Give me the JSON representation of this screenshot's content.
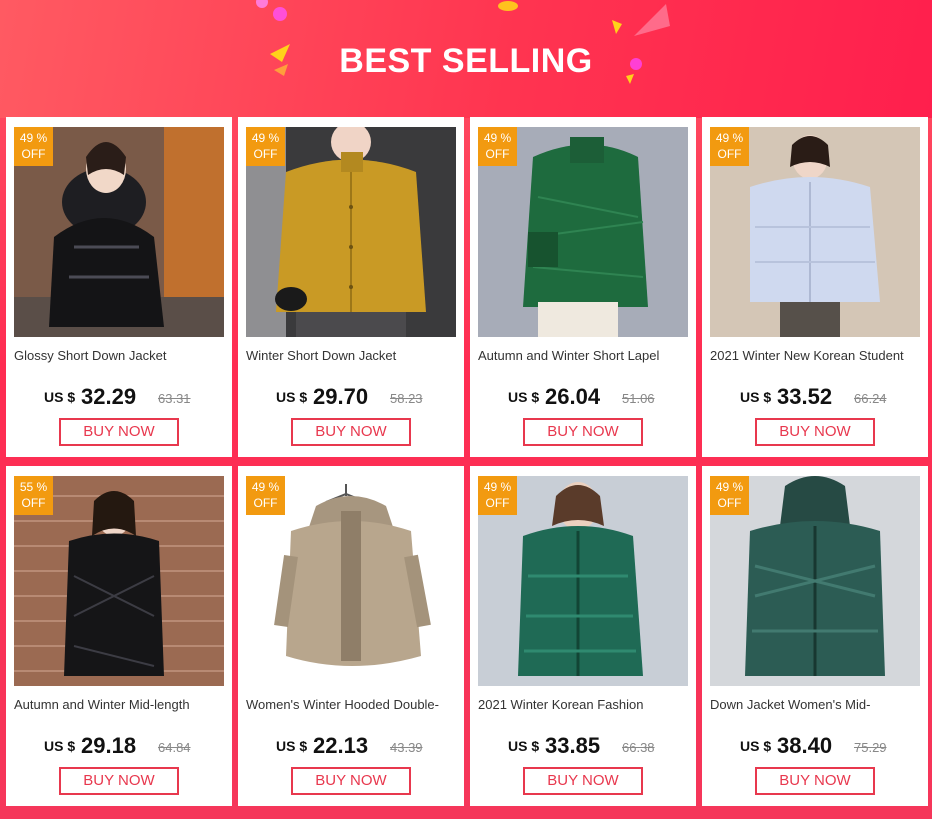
{
  "banner": {
    "title": "BEST SELLING"
  },
  "colors": {
    "accent": "#e8384e",
    "badge": "#f29a10",
    "background": "#ff3450"
  },
  "products": [
    {
      "name": "Glossy Short Down Jacket",
      "discount": "49 %",
      "off": "OFF",
      "currency": "US $",
      "price": "32.29",
      "old_price": "63.31",
      "button": "BUY NOW",
      "image": "black-glossy-fur-hood-jacket"
    },
    {
      "name": "Winter Short Down Jacket",
      "discount": "49 %",
      "off": "OFF",
      "currency": "US $",
      "price": "29.70",
      "old_price": "58.23",
      "button": "BUY NOW",
      "image": "mustard-short-down-jacket"
    },
    {
      "name": "Autumn and Winter Short Lapel",
      "discount": "49 %",
      "off": "OFF",
      "currency": "US $",
      "price": "26.04",
      "old_price": "51.06",
      "button": "BUY NOW",
      "image": "green-quilted-lapel-jacket"
    },
    {
      "name": "2021 Winter New Korean Student",
      "discount": "49 %",
      "off": "OFF",
      "currency": "US $",
      "price": "33.52",
      "old_price": "66.24",
      "button": "BUY NOW",
      "image": "light-blue-puffer-jacket"
    },
    {
      "name": "Autumn and Winter Mid-length",
      "discount": "55 %",
      "off": "OFF",
      "currency": "US $",
      "price": "29.18",
      "old_price": "64.84",
      "button": "BUY NOW",
      "image": "black-quilted-mid-length-coat"
    },
    {
      "name": "Women's Winter Hooded Double-",
      "discount": "49 %",
      "off": "OFF",
      "currency": "US $",
      "price": "22.13",
      "old_price": "43.39",
      "button": "BUY NOW",
      "image": "beige-fleece-hooded-coat"
    },
    {
      "name": "2021 Winter Korean Fashion",
      "discount": "49 %",
      "off": "OFF",
      "currency": "US $",
      "price": "33.85",
      "old_price": "66.38",
      "button": "BUY NOW",
      "image": "green-glossy-puffer-coat"
    },
    {
      "name": "Down Jacket Women's Mid-",
      "discount": "49 %",
      "off": "OFF",
      "currency": "US $",
      "price": "38.40",
      "old_price": "75.29",
      "button": "BUY NOW",
      "image": "dark-green-hooded-puffer-coat"
    }
  ]
}
